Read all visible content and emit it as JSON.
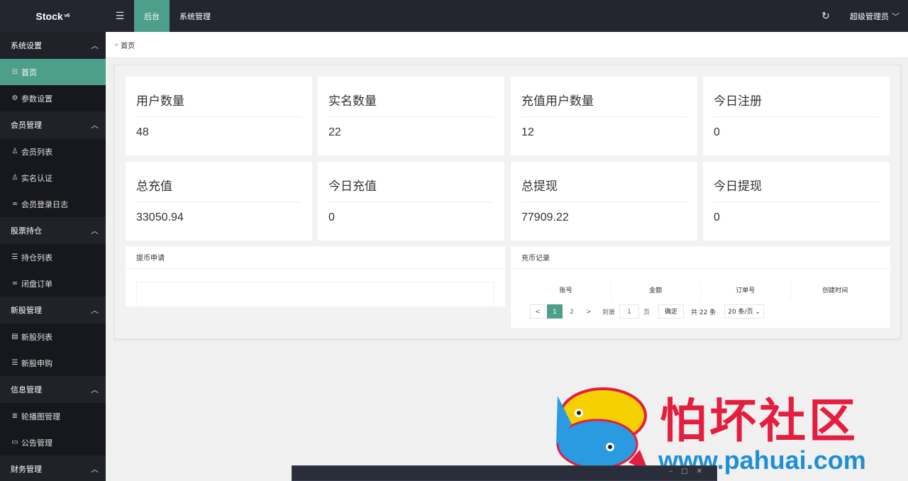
{
  "app": {
    "logo_text": "Stock",
    "logo_version": "v6"
  },
  "sidebar": {
    "groups": [
      {
        "label": "系统设置",
        "items": [
          {
            "label": "首页",
            "icon": "dashboard-icon",
            "active": true
          },
          {
            "label": "参数设置",
            "icon": "gear-icon"
          }
        ]
      },
      {
        "label": "会员管理",
        "items": [
          {
            "label": "会员列表",
            "icon": "user-icon"
          },
          {
            "label": "实名认证",
            "icon": "user-icon"
          },
          {
            "label": "会员登录日志",
            "icon": "link-icon"
          }
        ]
      },
      {
        "label": "股票持仓",
        "items": [
          {
            "label": "持仓列表",
            "icon": "list-icon"
          },
          {
            "label": "闭盘订单",
            "icon": "link-icon"
          }
        ]
      },
      {
        "label": "新股管理",
        "items": [
          {
            "label": "新股列表",
            "icon": "list-icon"
          },
          {
            "label": "新股申购",
            "icon": "list-icon"
          }
        ]
      },
      {
        "label": "信息管理",
        "items": [
          {
            "label": "轮播图管理",
            "icon": "menu-icon"
          },
          {
            "label": "公告管理",
            "icon": "window-icon"
          }
        ]
      },
      {
        "label": "财务管理",
        "items": []
      }
    ]
  },
  "topbar": {
    "tabs": [
      {
        "label": "后台",
        "active": true
      },
      {
        "label": "系统管理"
      }
    ],
    "user": "超级管理员"
  },
  "breadcrumb": {
    "current": "首页"
  },
  "stats": [
    {
      "title": "用户数量",
      "value": "48"
    },
    {
      "title": "实名数量",
      "value": "22"
    },
    {
      "title": "充值用户数量",
      "value": "12"
    },
    {
      "title": "今日注册",
      "value": "0"
    },
    {
      "title": "总充值",
      "value": "33050.94"
    },
    {
      "title": "今日充值",
      "value": "0"
    },
    {
      "title": "总提现",
      "value": "77909.22"
    },
    {
      "title": "今日提现",
      "value": "0"
    }
  ],
  "withdraw_panel": {
    "title": "提币申请"
  },
  "recharge_panel": {
    "title": "充币记录",
    "columns": [
      "账号",
      "金额",
      "订单号",
      "创建时间"
    ],
    "pager": {
      "prev": "<",
      "pages": [
        "1",
        "2"
      ],
      "current": "1",
      "next": ">",
      "goto_label": "到第",
      "goto_value": "1",
      "page_unit": "页",
      "confirm": "确定",
      "total": "共 22 条",
      "page_size": "20 条/页"
    }
  },
  "watermark": {
    "text": "怕坏社区",
    "url": "www.pahuai.com"
  },
  "colors": {
    "accent": "#4e9e8c",
    "sidebar": "#20222a",
    "topbar": "#23262e"
  }
}
